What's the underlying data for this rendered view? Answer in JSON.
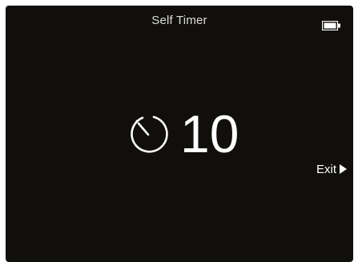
{
  "header": {
    "title": "Self Timer",
    "battery_icon": "battery-icon"
  },
  "timer": {
    "icon": "self-timer-icon",
    "seconds": "10"
  },
  "actions": {
    "exit_label": "Exit",
    "exit_icon": "play-arrow-icon"
  },
  "colors": {
    "screen_background": "#110f0c",
    "text": "#ffffff",
    "title_text": "#dcdcdc"
  }
}
